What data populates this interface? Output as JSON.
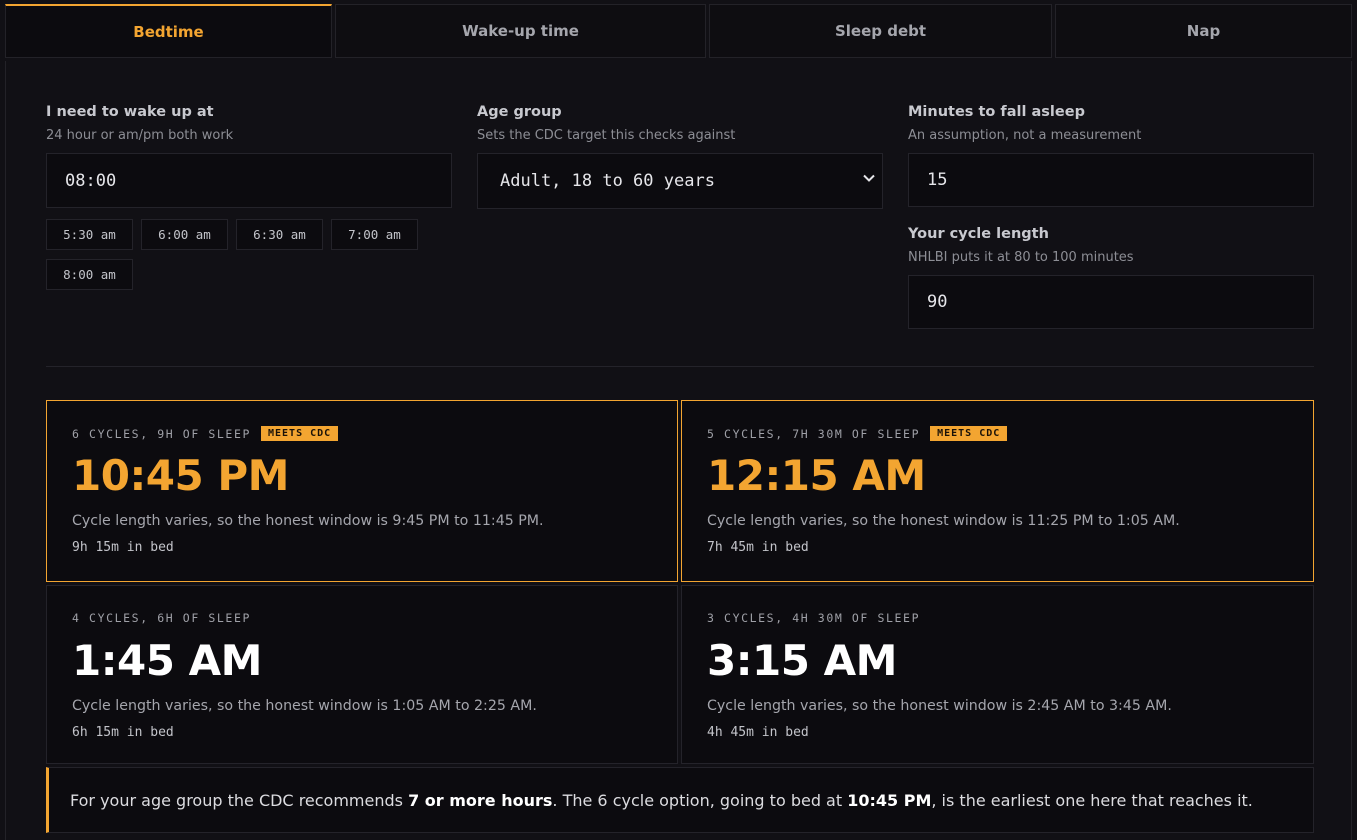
{
  "tabs": [
    {
      "label": "Bedtime",
      "active": true
    },
    {
      "label": "Wake-up time",
      "active": false
    },
    {
      "label": "Sleep debt",
      "active": false
    },
    {
      "label": "Nap",
      "active": false
    }
  ],
  "wake": {
    "label": "I need to wake up at",
    "hint": "24 hour or am/pm both work",
    "value": "08:00",
    "presets": [
      "5:30 am",
      "6:00 am",
      "6:30 am",
      "7:00 am",
      "8:00 am"
    ]
  },
  "age": {
    "label": "Age group",
    "hint": "Sets the CDC target this checks against",
    "selected": "Adult, 18 to 60 years"
  },
  "fall_asleep": {
    "label": "Minutes to fall asleep",
    "hint": "An assumption, not a measurement",
    "value": "15"
  },
  "cycle": {
    "label": "Your cycle length",
    "hint": "NHLBI puts it at 80 to 100 minutes",
    "value": "90"
  },
  "results": [
    {
      "meta": "6 CYCLES, 9H OF SLEEP",
      "badge": "MEETS CDC",
      "time": "10:45 PM",
      "window": "Cycle length varies, so the honest window is 9:45 PM to 11:45 PM.",
      "bed": "9h 15m in bed"
    },
    {
      "meta": "5 CYCLES, 7H 30M OF SLEEP",
      "badge": "MEETS CDC",
      "time": "12:15 AM",
      "window": "Cycle length varies, so the honest window is 11:25 PM to 1:05 AM.",
      "bed": "7h 45m in bed"
    },
    {
      "meta": "4 CYCLES, 6H OF SLEEP",
      "badge": "",
      "time": "1:45 AM",
      "window": "Cycle length varies, so the honest window is 1:05 AM to 2:25 AM.",
      "bed": "6h 15m in bed"
    },
    {
      "meta": "3 CYCLES, 4H 30M OF SLEEP",
      "badge": "",
      "time": "3:15 AM",
      "window": "Cycle length varies, so the honest window is 2:45 AM to 3:45 AM.",
      "bed": "4h 45m in bed"
    }
  ],
  "note": {
    "part1": "For your age group the CDC recommends ",
    "bold1": "7 or more hours",
    "part2": ". The 6 cycle option, going to bed at ",
    "bold2": "10:45 PM",
    "part3": ", is the earliest one here that reaches it."
  },
  "colors": {
    "accent": "#f3a531",
    "background": "#111015",
    "card": "#0c0b0f"
  },
  "icons": {
    "select": "chevron-down-icon"
  }
}
